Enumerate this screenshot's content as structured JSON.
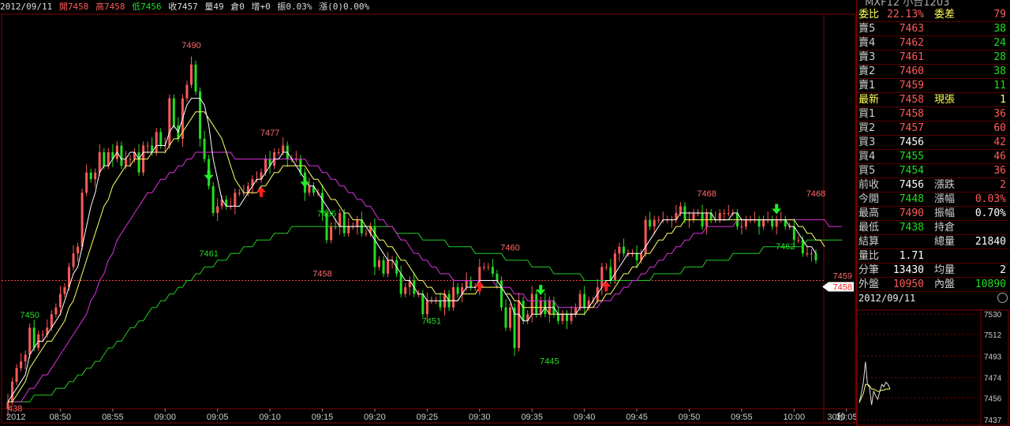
{
  "header": {
    "date": "2012/09/11",
    "open": "開7458",
    "high": "高7458",
    "low": "低7456",
    "close": "收7457",
    "volume": "量49",
    "oi": "倉0",
    "inc": "增+0",
    "amp": "振0.03%",
    "chg": "漲(0)0.00%"
  },
  "top_title": "MXF12 小台1203",
  "colors": {
    "up": "#ff5a5a",
    "down": "#22dd22",
    "ma5": "#ffffff",
    "ma10": "#ffff66",
    "ma20": "#dd33dd",
    "ma60": "#22cc22",
    "grid": "#800000",
    "ref": "#ff4040"
  },
  "quote": {
    "rows": [
      {
        "l1": "委比",
        "v1": "22.13%",
        "c1": "#ff5a5a",
        "l2": "委差",
        "v2": "79",
        "c2": "#ff5a5a",
        "hl": true
      },
      {
        "l1": "賣5",
        "v1": "7463",
        "c1": "#ff5a5a",
        "l2": "",
        "v2": "38",
        "c2": "#22dd22"
      },
      {
        "l1": "賣4",
        "v1": "7462",
        "c1": "#ff5a5a",
        "l2": "",
        "v2": "24",
        "c2": "#22dd22"
      },
      {
        "l1": "賣3",
        "v1": "7461",
        "c1": "#ff5a5a",
        "l2": "",
        "v2": "28",
        "c2": "#22dd22"
      },
      {
        "l1": "賣2",
        "v1": "7460",
        "c1": "#ff5a5a",
        "l2": "",
        "v2": "38",
        "c2": "#22dd22"
      },
      {
        "l1": "賣1",
        "v1": "7459",
        "c1": "#ff5a5a",
        "l2": "",
        "v2": "11",
        "c2": "#22dd22"
      },
      {
        "l1": "最新",
        "v1": "7458",
        "c1": "#ff5a5a",
        "l2": "現張",
        "v2": "1",
        "c2": "#ffff55",
        "hl": true
      },
      {
        "l1": "買1",
        "v1": "7458",
        "c1": "#ff5a5a",
        "l2": "",
        "v2": "36",
        "c2": "#ff5a5a"
      },
      {
        "l1": "買2",
        "v1": "7457",
        "c1": "#ff5a5a",
        "l2": "",
        "v2": "60",
        "c2": "#ff5a5a"
      },
      {
        "l1": "買3",
        "v1": "7456",
        "c1": "#ffffff",
        "l2": "",
        "v2": "42",
        "c2": "#ff5a5a"
      },
      {
        "l1": "買4",
        "v1": "7455",
        "c1": "#22dd22",
        "l2": "",
        "v2": "46",
        "c2": "#ff5a5a"
      },
      {
        "l1": "買5",
        "v1": "7454",
        "c1": "#22dd22",
        "l2": "",
        "v2": "36",
        "c2": "#ff5a5a"
      },
      {
        "l1": "前收",
        "v1": "7456",
        "c1": "#ffffff",
        "l2": "漲跌",
        "v2": "2",
        "c2": "#ff5a5a"
      },
      {
        "l1": "今開",
        "v1": "7448",
        "c1": "#22dd22",
        "l2": "漲幅",
        "v2": "0.03%",
        "c2": "#ff5a5a"
      },
      {
        "l1": "最高",
        "v1": "7490",
        "c1": "#ff5a5a",
        "l2": "振幅",
        "v2": "0.70%",
        "c2": "#ffffff"
      },
      {
        "l1": "最低",
        "v1": "7438",
        "c1": "#22dd22",
        "l2": "持倉",
        "v2": "",
        "c2": "#ffffff"
      },
      {
        "l1": "結算",
        "v1": "",
        "c1": "#ffffff",
        "l2": "總量",
        "v2": "21840",
        "c2": "#ffffff"
      },
      {
        "l1": "量比",
        "v1": "1.71",
        "c1": "#ffffff",
        "l2": "",
        "v2": "",
        "c2": "#ffffff"
      },
      {
        "l1": "分筆",
        "v1": "13430",
        "c1": "#ffffff",
        "l2": "均量",
        "v2": "2",
        "c2": "#ffffff"
      },
      {
        "l1": "外盤",
        "v1": "10950",
        "c1": "#ff5a5a",
        "l2": "內盤",
        "v2": "10890",
        "c2": "#22dd22"
      }
    ],
    "date": "2012/09/11"
  },
  "mini_chart": {
    "ticks": [
      "7530",
      "7512",
      "7493",
      "7474",
      "7456",
      "7437"
    ],
    "ylim": [
      7437,
      7530
    ],
    "x": [
      0,
      2,
      4,
      6,
      8,
      10,
      12,
      14,
      16,
      18,
      20,
      22,
      24,
      26,
      28,
      30
    ],
    "values": [
      7452,
      7460,
      7470,
      7488,
      7468,
      7465,
      7450,
      7462,
      7458,
      7455,
      7462,
      7468,
      7466,
      7470,
      7468,
      7464
    ],
    "avg": [
      7452,
      7456,
      7460,
      7468,
      7468,
      7467,
      7464,
      7464,
      7463,
      7462,
      7462,
      7463,
      7463,
      7464,
      7464,
      7464
    ]
  },
  "chart_data": {
    "type": "candlestick",
    "title": "",
    "ylim": [
      7437,
      7495
    ],
    "ref_line": 7456,
    "ref_label": "7458",
    "last_label": "7459",
    "x_labels": [
      "2012",
      "08:50",
      "08:55",
      "09:00",
      "09:05",
      "09:10",
      "09:15",
      "09:20",
      "09:25",
      "09:30",
      "09:35",
      "09:40",
      "09:45",
      "09:50",
      "09:55",
      "10:00",
      "10:05"
    ],
    "x_label_index": [
      0,
      12,
      24,
      36,
      48,
      60,
      72,
      84,
      96,
      108,
      120,
      132,
      144,
      156,
      168,
      180,
      192
    ],
    "period_label": "30秒",
    "price_labels": [
      {
        "i": 0,
        "v": 7438,
        "text": "438"
      },
      {
        "i": 5,
        "v": 7450,
        "text": "7450"
      },
      {
        "i": 42,
        "v": 7490,
        "text": "7490"
      },
      {
        "i": 46,
        "v": 7461,
        "text": "7461"
      },
      {
        "i": 60,
        "v": 7477,
        "text": "7477"
      },
      {
        "i": 73,
        "v": 7465,
        "text": "7465"
      },
      {
        "i": 72,
        "v": 7458,
        "text": "7458"
      },
      {
        "i": 97,
        "v": 7451,
        "text": "7451"
      },
      {
        "i": 115,
        "v": 7460,
        "text": "7460"
      },
      {
        "i": 124,
        "v": 7445,
        "text": "7445"
      },
      {
        "i": 160,
        "v": 7468,
        "text": "7468"
      },
      {
        "i": 178,
        "v": 7462,
        "text": "7462"
      },
      {
        "i": 185,
        "v": 7468,
        "text": "7468"
      }
    ],
    "signals": [
      {
        "i": 46,
        "dir": "down"
      },
      {
        "i": 58,
        "dir": "up"
      },
      {
        "i": 68,
        "dir": "down"
      },
      {
        "i": 108,
        "dir": "up"
      },
      {
        "i": 122,
        "dir": "down"
      },
      {
        "i": 137,
        "dir": "up"
      },
      {
        "i": 176,
        "dir": "down"
      },
      {
        "i": 186,
        "dir": "up"
      },
      {
        "i": 190,
        "dir": "down"
      }
    ],
    "close": [
      7438,
      7441,
      7443,
      7444,
      7445,
      7449,
      7446,
      7448,
      7448,
      7449,
      7451,
      7452,
      7454,
      7455,
      7458,
      7460,
      7461,
      7469,
      7472,
      7471,
      7472,
      7475,
      7473,
      7475,
      7474,
      7476,
      7473,
      7474,
      7474,
      7475,
      7472,
      7476,
      7476,
      7475,
      7478,
      7476,
      7476,
      7483,
      7479,
      7477,
      7483,
      7485,
      7488,
      7484,
      7477,
      7474,
      7470,
      7466,
      7467,
      7468,
      7467,
      7467,
      7469,
      7469,
      7469,
      7470,
      7471,
      7471,
      7472,
      7474,
      7473,
      7475,
      7475,
      7476,
      7474,
      7474,
      7474,
      7472,
      7469,
      7470,
      7469,
      7469,
      7466,
      7462,
      7464,
      7464,
      7466,
      7463,
      7464,
      7464,
      7465,
      7463,
      7463,
      7464,
      7458,
      7459,
      7457,
      7459,
      7459,
      7457,
      7454,
      7455,
      7456,
      7454,
      7454,
      7451,
      7453,
      7453,
      7453,
      7452,
      7454,
      7452,
      7455,
      7454,
      7455,
      7456,
      7455,
      7455,
      7458,
      7458,
      7458,
      7457,
      7456,
      7452,
      7449,
      7452,
      7446,
      7453,
      7450,
      7451,
      7454,
      7451,
      7453,
      7451,
      7453,
      7451,
      7450,
      7451,
      7450,
      7451,
      7452,
      7454,
      7452,
      7453,
      7453,
      7455,
      7458,
      7458,
      7456,
      7460,
      7461,
      7460,
      7460,
      7460,
      7459,
      7460,
      7465,
      7464,
      7465,
      7465,
      7465,
      7465,
      7465,
      7466,
      7467,
      7465,
      7465,
      7466,
      7466,
      7464,
      7466,
      7465,
      7465,
      7466,
      7466,
      7466,
      7466,
      7464,
      7464,
      7465,
      7465,
      7465,
      7464,
      7465,
      7465,
      7464,
      7465,
      7465,
      7464,
      7464,
      7462,
      7462,
      7460,
      7460,
      7460,
      7459
    ],
    "ma5": [
      7438,
      7439,
      7440,
      7441,
      7442,
      7445,
      7446,
      7447,
      7447,
      7448,
      7449,
      7450,
      7451,
      7453,
      7455,
      7457,
      7458,
      7461,
      7464,
      7467,
      7469,
      7472,
      7473,
      7473,
      7474,
      7475,
      7474,
      7474,
      7475,
      7475,
      7474,
      7475,
      7475,
      7475,
      7476,
      7476,
      7476,
      7478,
      7479,
      7478,
      7480,
      7482,
      7483,
      7483,
      7483,
      7482,
      7479,
      7474,
      7471,
      7468,
      7467,
      7467,
      7467,
      7467,
      7468,
      7469,
      7470,
      7471,
      7471,
      7472,
      7473,
      7474,
      7474,
      7475,
      7475,
      7474,
      7473,
      7472,
      7471,
      7470,
      7470,
      7469,
      7468,
      7467,
      7466,
      7465,
      7464,
      7464,
      7464,
      7464,
      7464,
      7464,
      7464,
      7463,
      7462,
      7461,
      7460,
      7459,
      7459,
      7458,
      7457,
      7456,
      7456,
      7455,
      7454,
      7454,
      7453,
      7453,
      7453,
      7453,
      7453,
      7453,
      7453,
      7453,
      7454,
      7455,
      7455,
      7455,
      7456,
      7456,
      7456,
      7456,
      7456,
      7455,
      7454,
      7453,
      7451,
      7451,
      7450,
      7450,
      7451,
      7451,
      7451,
      7452,
      7452,
      7452,
      7451,
      7451,
      7451,
      7451,
      7451,
      7452,
      7452,
      7452,
      7453,
      7454,
      7455,
      7456,
      7456,
      7457,
      7458,
      7459,
      7460,
      7460,
      7460,
      7460,
      7461,
      7462,
      7463,
      7464,
      7465,
      7465,
      7465,
      7465,
      7466,
      7466,
      7466,
      7466,
      7466,
      7466,
      7466,
      7466,
      7465,
      7465,
      7465,
      7465,
      7466,
      7466,
      7465,
      7465,
      7465,
      7465,
      7465,
      7465,
      7465,
      7465,
      7465,
      7465,
      7465,
      7464,
      7464,
      7463,
      7462,
      7461,
      7461,
      7460
    ],
    "ma10": [
      7438,
      7438,
      7439,
      7440,
      7441,
      7443,
      7444,
      7445,
      7446,
      7447,
      7447,
      7448,
      7449,
      7450,
      7452,
      7453,
      7455,
      7457,
      7459,
      7461,
      7463,
      7465,
      7467,
      7468,
      7470,
      7471,
      7472,
      7473,
      7473,
      7474,
      7474,
      7474,
      7474,
      7475,
      7475,
      7475,
      7475,
      7476,
      7477,
      7477,
      7478,
      7479,
      7480,
      7481,
      7481,
      7481,
      7480,
      7479,
      7478,
      7477,
      7475,
      7473,
      7471,
      7470,
      7469,
      7469,
      7469,
      7469,
      7470,
      7470,
      7471,
      7472,
      7472,
      7473,
      7473,
      7473,
      7473,
      7473,
      7473,
      7472,
      7471,
      7471,
      7470,
      7469,
      7468,
      7468,
      7467,
      7466,
      7466,
      7465,
      7465,
      7465,
      7464,
      7464,
      7463,
      7462,
      7462,
      7461,
      7461,
      7460,
      7459,
      7459,
      7458,
      7457,
      7456,
      7456,
      7455,
      7455,
      7454,
      7454,
      7454,
      7453,
      7453,
      7453,
      7454,
      7454,
      7454,
      7454,
      7455,
      7455,
      7455,
      7455,
      7455,
      7455,
      7454,
      7454,
      7453,
      7453,
      7452,
      7452,
      7452,
      7452,
      7452,
      7452,
      7451,
      7451,
      7451,
      7451,
      7451,
      7451,
      7451,
      7451,
      7451,
      7452,
      7452,
      7453,
      7453,
      7454,
      7454,
      7455,
      7456,
      7457,
      7457,
      7458,
      7458,
      7459,
      7460,
      7460,
      7461,
      7462,
      7462,
      7463,
      7463,
      7464,
      7464,
      7465,
      7465,
      7465,
      7465,
      7465,
      7465,
      7465,
      7465,
      7465,
      7465,
      7465,
      7465,
      7465,
      7465,
      7465,
      7465,
      7465,
      7465,
      7465,
      7465,
      7465,
      7465,
      7465,
      7465,
      7465,
      7465,
      7464,
      7464,
      7463,
      7463,
      7462,
      7462,
      7461
    ],
    "ma20": [
      7438,
      7438,
      7438,
      7438,
      7439,
      7440,
      7440,
      7441,
      7442,
      7442,
      7443,
      7444,
      7445,
      7446,
      7447,
      7448,
      7449,
      7450,
      7451,
      7453,
      7454,
      7456,
      7457,
      7459,
      7460,
      7462,
      7463,
      7464,
      7465,
      7466,
      7467,
      7468,
      7469,
      7469,
      7470,
      7471,
      7471,
      7472,
      7472,
      7473,
      7473,
      7474,
      7474,
      7475,
      7475,
      7475,
      7475,
      7475,
      7475,
      7475,
      7475,
      7475,
      7474,
      7474,
      7474,
      7474,
      7474,
      7474,
      7474,
      7474,
      7474,
      7474,
      7474,
      7474,
      7474,
      7474,
      7474,
      7474,
      7474,
      7473,
      7473,
      7473,
      7472,
      7472,
      7471,
      7471,
      7470,
      7470,
      7469,
      7469,
      7468,
      7468,
      7467,
      7467,
      7466,
      7465,
      7465,
      7464,
      7464,
      7463,
      7462,
      7462,
      7461,
      7460,
      7460,
      7459,
      7459,
      7458,
      7458,
      7457,
      7457,
      7457,
      7456,
      7456,
      7456,
      7456,
      7456,
      7456,
      7456,
      7456,
      7456,
      7456,
      7455,
      7455,
      7455,
      7455,
      7454,
      7454,
      7454,
      7453,
      7453,
      7453,
      7453,
      7453,
      7453,
      7453,
      7452,
      7452,
      7452,
      7452,
      7452,
      7452,
      7452,
      7452,
      7452,
      7452,
      7453,
      7453,
      7453,
      7454,
      7454,
      7455,
      7455,
      7456,
      7456,
      7457,
      7457,
      7458,
      7458,
      7459,
      7459,
      7460,
      7460,
      7461,
      7461,
      7462,
      7462,
      7463,
      7463,
      7463,
      7464,
      7464,
      7464,
      7464,
      7464,
      7464,
      7464,
      7465,
      7465,
      7465,
      7465,
      7465,
      7465,
      7465,
      7465,
      7465,
      7465,
      7465,
      7465,
      7465,
      7465,
      7465,
      7465,
      7465,
      7465,
      7465,
      7465,
      7465,
      7464,
      7464,
      7464,
      7464
    ],
    "ma60": [
      7438,
      7438,
      7438,
      7438,
      7438,
      7438,
      7439,
      7439,
      7439,
      7439,
      7439,
      7440,
      7440,
      7440,
      7441,
      7441,
      7442,
      7442,
      7443,
      7443,
      7444,
      7444,
      7445,
      7446,
      7446,
      7447,
      7447,
      7448,
      7449,
      7449,
      7450,
      7450,
      7451,
      7452,
      7452,
      7453,
      7453,
      7454,
      7454,
      7455,
      7455,
      7456,
      7456,
      7457,
      7457,
      7458,
      7458,
      7458,
      7459,
      7459,
      7459,
      7460,
      7460,
      7460,
      7461,
      7461,
      7461,
      7462,
      7462,
      7462,
      7462,
      7463,
      7463,
      7463,
      7463,
      7464,
      7464,
      7464,
      7464,
      7464,
      7464,
      7464,
      7464,
      7464,
      7464,
      7464,
      7464,
      7464,
      7464,
      7464,
      7464,
      7464,
      7464,
      7464,
      7464,
      7464,
      7464,
      7464,
      7464,
      7463,
      7463,
      7463,
      7463,
      7463,
      7463,
      7462,
      7462,
      7462,
      7462,
      7462,
      7462,
      7461,
      7461,
      7461,
      7461,
      7461,
      7461,
      7460,
      7460,
      7460,
      7460,
      7460,
      7460,
      7460,
      7459,
      7459,
      7459,
      7459,
      7459,
      7459,
      7458,
      7458,
      7458,
      7458,
      7458,
      7457,
      7457,
      7457,
      7457,
      7457,
      7457,
      7457,
      7456,
      7456,
      7456,
      7456,
      7456,
      7456,
      7456,
      7456,
      7456,
      7456,
      7456,
      7456,
      7456,
      7456,
      7456,
      7456,
      7457,
      7457,
      7457,
      7457,
      7457,
      7457,
      7457,
      7458,
      7458,
      7458,
      7458,
      7458,
      7459,
      7459,
      7459,
      7459,
      7459,
      7459,
      7460,
      7460,
      7460,
      7460,
      7460,
      7460,
      7460,
      7461,
      7461,
      7461,
      7461,
      7461,
      7461,
      7461,
      7461,
      7461,
      7461,
      7462,
      7462,
      7462,
      7462,
      7462,
      7462,
      7462,
      7462,
      7462
    ]
  }
}
